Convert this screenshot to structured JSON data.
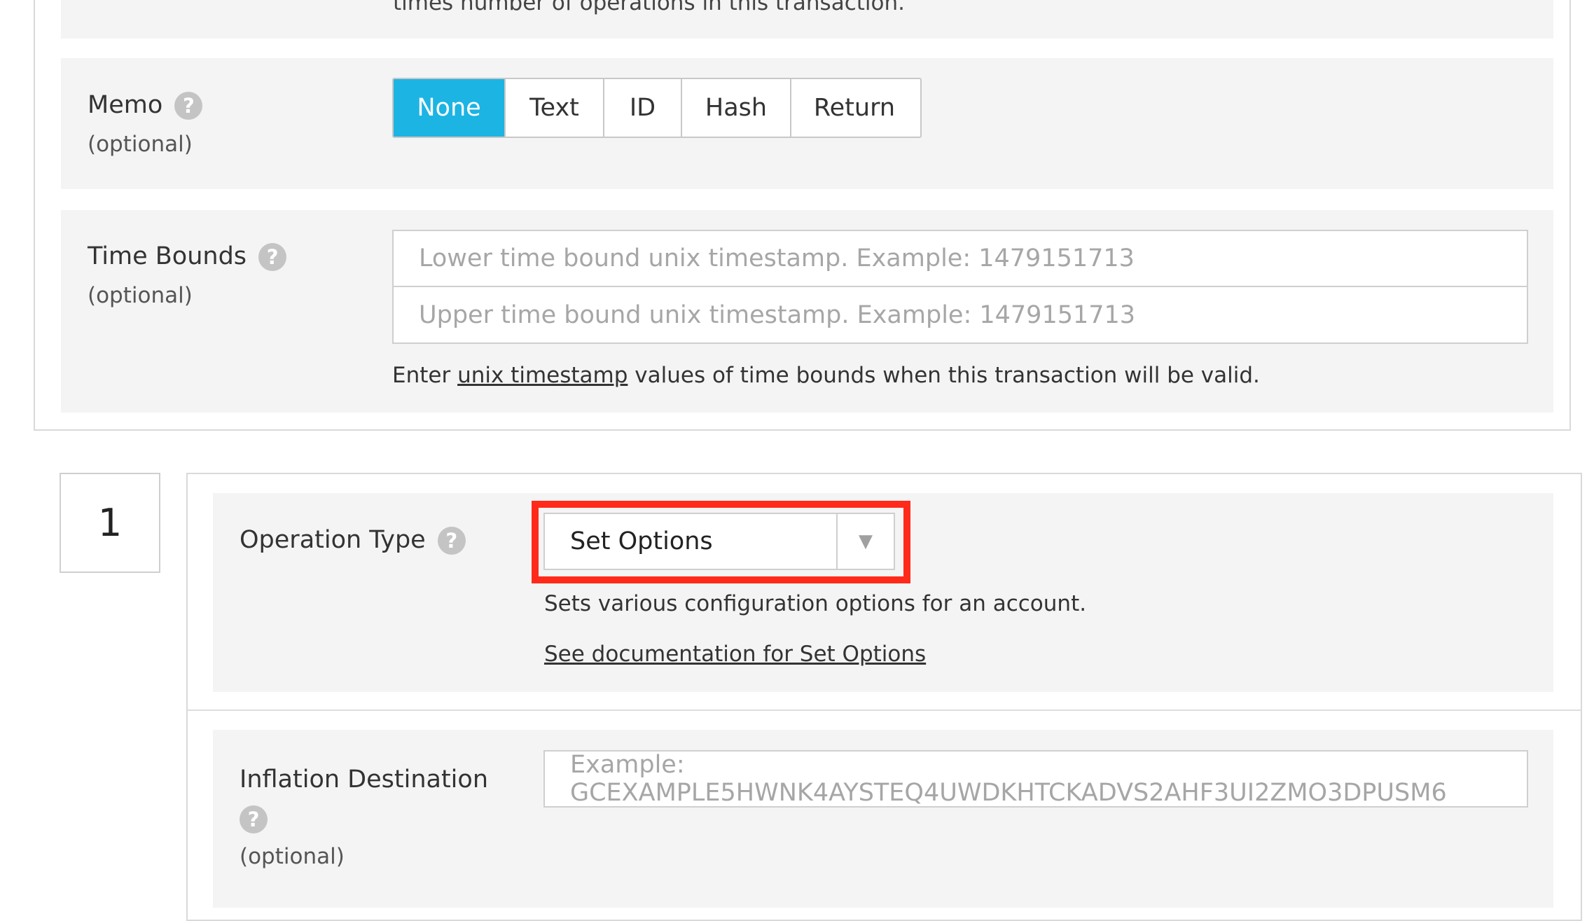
{
  "top_hint": "times number of operations in this transaction.",
  "memo": {
    "label": "Memo",
    "help_icon": "?",
    "optional": "(optional)",
    "options": [
      "None",
      "Text",
      "ID",
      "Hash",
      "Return"
    ],
    "selected": "None"
  },
  "time_bounds": {
    "label": "Time Bounds",
    "help_icon": "?",
    "optional": "(optional)",
    "lower_placeholder": "Lower time bound unix timestamp. Example: 1479151713",
    "upper_placeholder": "Upper time bound unix timestamp.  Example: 1479151713",
    "hint_pre": "Enter",
    "hint_link": "unix timestamp",
    "hint_post": "values of time bounds when this transaction will be valid."
  },
  "operation": {
    "index": "1",
    "type_label": "Operation Type",
    "help_icon": "?",
    "selected_type": "Set Options",
    "dropdown_arrow": "▼",
    "description": "Sets various configuration options for an account.",
    "doc_link": "See documentation for Set Options"
  },
  "inflation": {
    "label": "Inflation Destination",
    "help_icon": "?",
    "optional": "(optional)",
    "placeholder": "Example: GCEXAMPLE5HWNK4AYSTEQ4UWDKHTCKADVS2AHF3UI2ZMO3DPUSM6"
  },
  "colors": {
    "accent": "#1cb4e3",
    "highlight": "#ff2a1a",
    "row_bg": "#f4f4f4"
  }
}
